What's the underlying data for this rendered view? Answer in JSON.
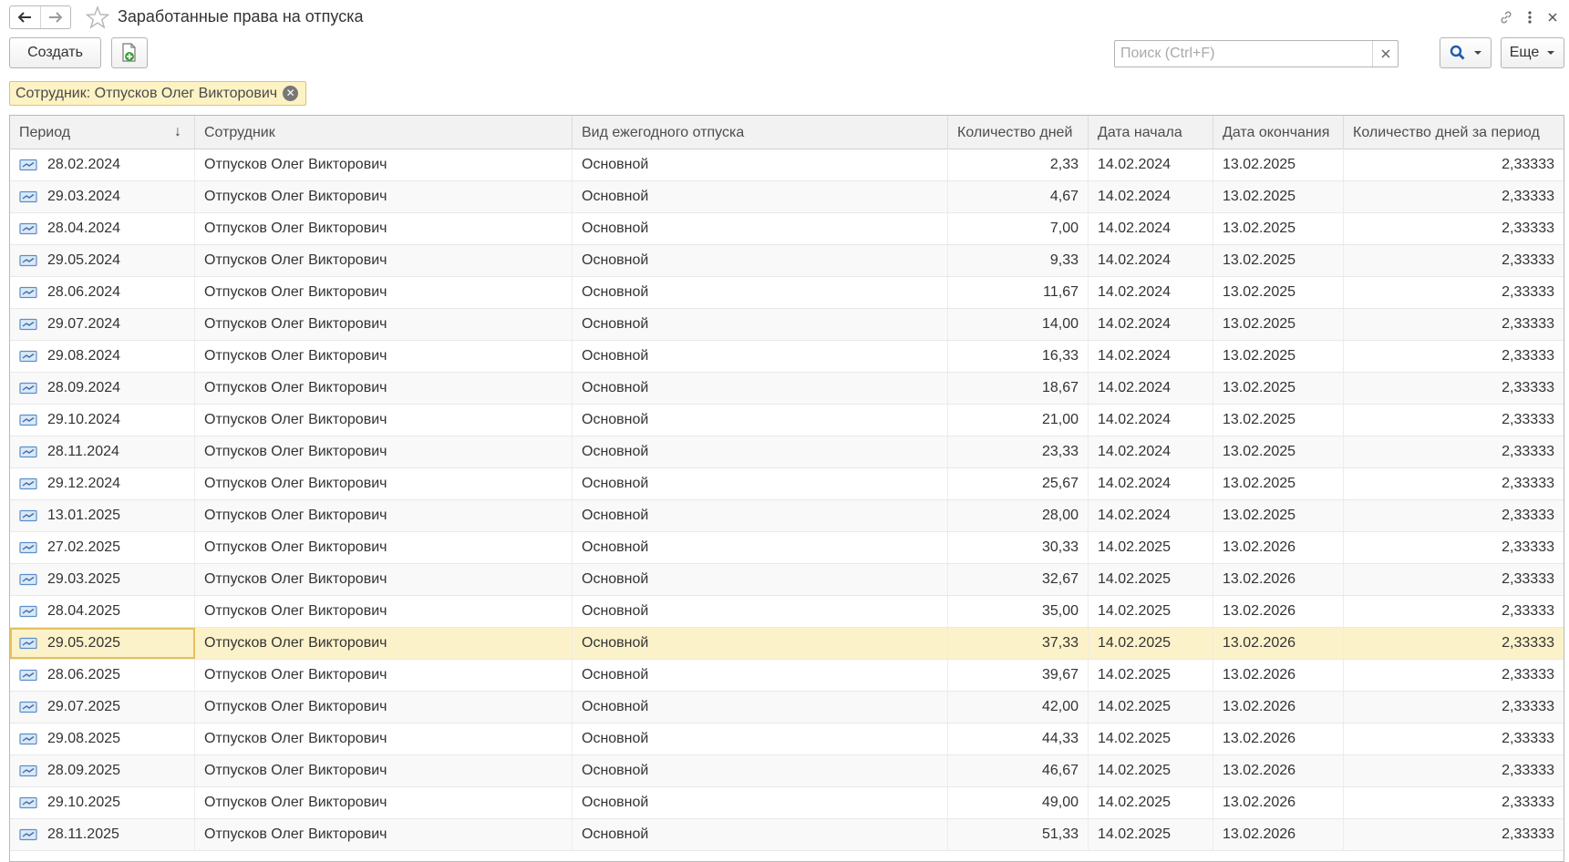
{
  "window": {
    "title": "Заработанные права на отпуска"
  },
  "toolbar": {
    "create_label": "Создать",
    "search_placeholder": "Поиск (Ctrl+F)",
    "search_value": "",
    "more_label": "Еще"
  },
  "filter": {
    "label": "Сотрудник: Отпусков Олег Викторович"
  },
  "table": {
    "columns": [
      "Период",
      "Сотрудник",
      "Вид ежегодного отпуска",
      "Количество дней",
      "Дата начала",
      "Дата окончания",
      "Количество дней за период"
    ],
    "sort_column": "Период",
    "sort_direction": "ascending",
    "selected_row_index": 15,
    "rows": [
      [
        "28.02.2024",
        "Отпусков Олег Викторович",
        "Основной",
        "2,33",
        "14.02.2024",
        "13.02.2025",
        "2,33333"
      ],
      [
        "29.03.2024",
        "Отпусков Олег Викторович",
        "Основной",
        "4,67",
        "14.02.2024",
        "13.02.2025",
        "2,33333"
      ],
      [
        "28.04.2024",
        "Отпусков Олег Викторович",
        "Основной",
        "7,00",
        "14.02.2024",
        "13.02.2025",
        "2,33333"
      ],
      [
        "29.05.2024",
        "Отпусков Олег Викторович",
        "Основной",
        "9,33",
        "14.02.2024",
        "13.02.2025",
        "2,33333"
      ],
      [
        "28.06.2024",
        "Отпусков Олег Викторович",
        "Основной",
        "11,67",
        "14.02.2024",
        "13.02.2025",
        "2,33333"
      ],
      [
        "29.07.2024",
        "Отпусков Олег Викторович",
        "Основной",
        "14,00",
        "14.02.2024",
        "13.02.2025",
        "2,33333"
      ],
      [
        "29.08.2024",
        "Отпусков Олег Викторович",
        "Основной",
        "16,33",
        "14.02.2024",
        "13.02.2025",
        "2,33333"
      ],
      [
        "28.09.2024",
        "Отпусков Олег Викторович",
        "Основной",
        "18,67",
        "14.02.2024",
        "13.02.2025",
        "2,33333"
      ],
      [
        "29.10.2024",
        "Отпусков Олег Викторович",
        "Основной",
        "21,00",
        "14.02.2024",
        "13.02.2025",
        "2,33333"
      ],
      [
        "28.11.2024",
        "Отпусков Олег Викторович",
        "Основной",
        "23,33",
        "14.02.2024",
        "13.02.2025",
        "2,33333"
      ],
      [
        "29.12.2024",
        "Отпусков Олег Викторович",
        "Основной",
        "25,67",
        "14.02.2024",
        "13.02.2025",
        "2,33333"
      ],
      [
        "13.01.2025",
        "Отпусков Олег Викторович",
        "Основной",
        "28,00",
        "14.02.2024",
        "13.02.2025",
        "2,33333"
      ],
      [
        "27.02.2025",
        "Отпусков Олег Викторович",
        "Основной",
        "30,33",
        "14.02.2025",
        "13.02.2026",
        "2,33333"
      ],
      [
        "29.03.2025",
        "Отпусков Олег Викторович",
        "Основной",
        "32,67",
        "14.02.2025",
        "13.02.2026",
        "2,33333"
      ],
      [
        "28.04.2025",
        "Отпусков Олег Викторович",
        "Основной",
        "35,00",
        "14.02.2025",
        "13.02.2026",
        "2,33333"
      ],
      [
        "29.05.2025",
        "Отпусков Олег Викторович",
        "Основной",
        "37,33",
        "14.02.2025",
        "13.02.2026",
        "2,33333"
      ],
      [
        "28.06.2025",
        "Отпусков Олег Викторович",
        "Основной",
        "39,67",
        "14.02.2025",
        "13.02.2026",
        "2,33333"
      ],
      [
        "29.07.2025",
        "Отпусков Олег Викторович",
        "Основной",
        "42,00",
        "14.02.2025",
        "13.02.2026",
        "2,33333"
      ],
      [
        "29.08.2025",
        "Отпусков Олег Викторович",
        "Основной",
        "44,33",
        "14.02.2025",
        "13.02.2026",
        "2,33333"
      ],
      [
        "28.09.2025",
        "Отпусков Олег Викторович",
        "Основной",
        "46,67",
        "14.02.2025",
        "13.02.2026",
        "2,33333"
      ],
      [
        "29.10.2025",
        "Отпусков Олег Викторович",
        "Основной",
        "49,00",
        "14.02.2025",
        "13.02.2026",
        "2,33333"
      ],
      [
        "28.11.2025",
        "Отпусков Олег Викторович",
        "Основной",
        "51,33",
        "14.02.2025",
        "13.02.2026",
        "2,33333"
      ]
    ]
  },
  "colors": {
    "selected_row": "#fcf2ca",
    "filter_tag_bg": "#fdf2c4",
    "search_accent": "#1e5ca8"
  }
}
